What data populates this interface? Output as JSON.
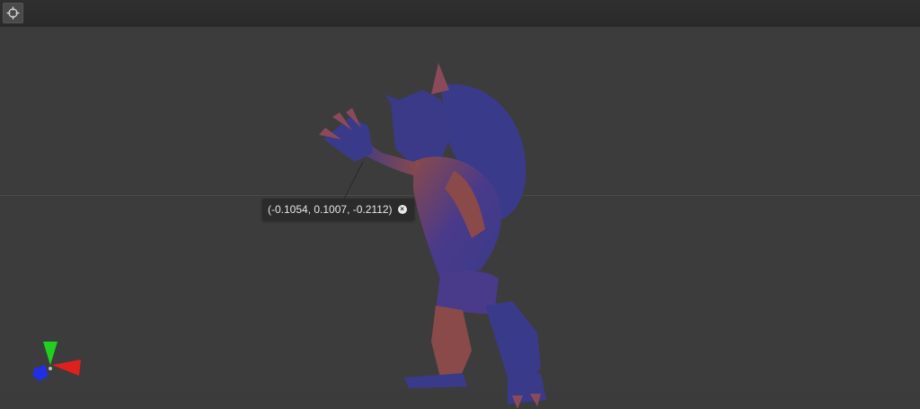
{
  "toolbar": {
    "buttons": [
      {
        "icon": "crosshair-icon",
        "color": "#d9d9d9"
      }
    ]
  },
  "viewport": {
    "background": "#3c3c3c",
    "model": {
      "colors": {
        "primary": "#3a3a8a",
        "shade": "#8a4a4a",
        "highlight": "#b07070"
      }
    },
    "pick_readout": {
      "text": "(-0.1054, 0.1007, -0.2112)",
      "close_icon": "close-circle-icon"
    },
    "axis_gizmo": {
      "x_color": "#e0201c",
      "y_color": "#20d020",
      "z_color": "#2030e0"
    }
  }
}
